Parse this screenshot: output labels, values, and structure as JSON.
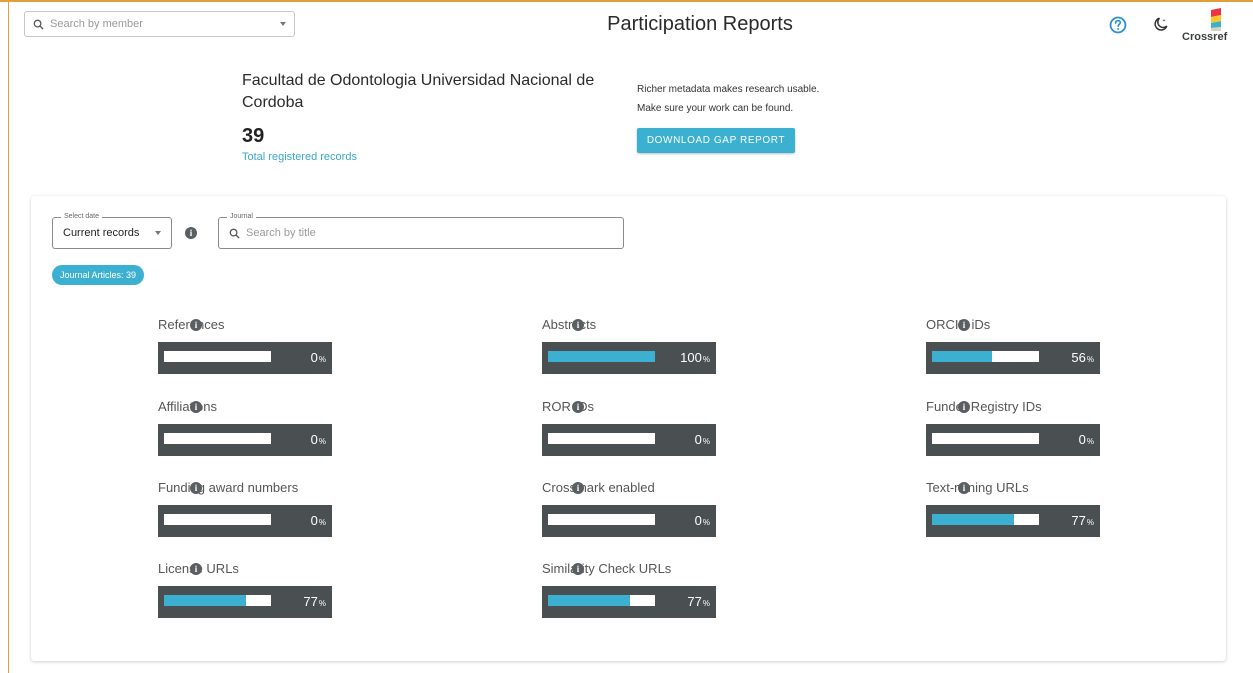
{
  "header": {
    "member_search_placeholder": "Search by member",
    "title": "Participation Reports",
    "logo_text": "Crossref",
    "icons": [
      "help-circle-icon",
      "moon-icon",
      "crossref-logo"
    ],
    "colors": {
      "accent": "#3bb0d0",
      "frame": "#e0a03a",
      "metric_bg": "#4a5051"
    }
  },
  "summary": {
    "org_name": "Facultad de Odontologia Universidad Nacional de Cordoba",
    "total_count": "39",
    "total_label": "Total registered records",
    "promo_line1": "Richer metadata makes research usable.",
    "promo_line2": "Make sure your work can be found.",
    "gap_button": "DOWNLOAD GAP REPORT"
  },
  "filters": {
    "date_legend": "Select date",
    "date_value": "Current records",
    "journal_legend": "Journal",
    "journal_placeholder": "Search by title",
    "chip": "Journal Articles: 39"
  },
  "metrics": [
    {
      "label": "References",
      "value": "0",
      "unit": "%",
      "fraction": 0
    },
    {
      "label": "Abstracts",
      "value": "100",
      "unit": "%",
      "fraction": 1.0
    },
    {
      "label": "ORCID iDs",
      "value": "56",
      "unit": "%",
      "fraction": 0.56
    },
    {
      "label": "Affiliations",
      "value": "0",
      "unit": "%",
      "fraction": 0
    },
    {
      "label": "ROR IDs",
      "value": "0",
      "unit": "%",
      "fraction": 0
    },
    {
      "label": "Funder Registry IDs",
      "value": "0",
      "unit": "%",
      "fraction": 0
    },
    {
      "label": "Funding award numbers",
      "value": "0",
      "unit": "%",
      "fraction": 0
    },
    {
      "label": "Crossmark enabled",
      "value": "0",
      "unit": "%",
      "fraction": 0
    },
    {
      "label": "Text-mining URLs",
      "value": "77",
      "unit": "%",
      "fraction": 0.77
    },
    {
      "label": "License URLs",
      "value": "77",
      "unit": "%",
      "fraction": 0.77
    },
    {
      "label": "Similarity Check URLs",
      "value": "77",
      "unit": "%",
      "fraction": 0.77
    }
  ]
}
